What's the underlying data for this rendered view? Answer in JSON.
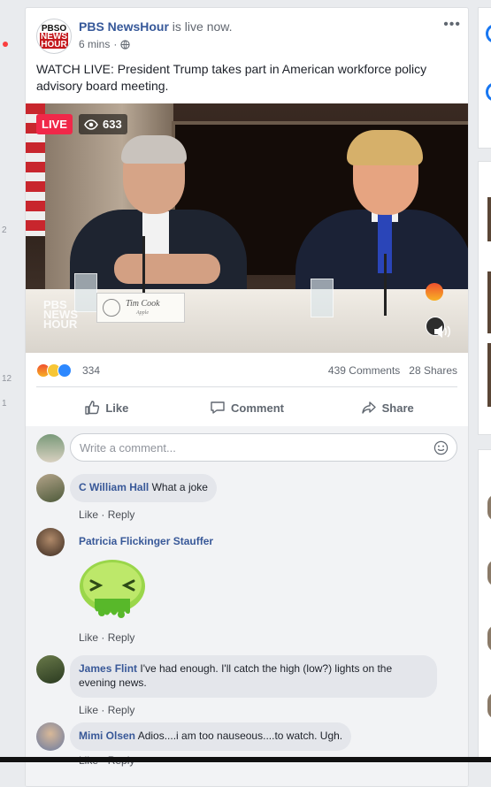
{
  "gutter": {
    "numbers": [
      "2",
      "12",
      "1"
    ]
  },
  "post": {
    "page_name": "PBS NewsHour",
    "live_status": " is live now.",
    "time_ago": "6 mins",
    "audience_icon": "globe-icon",
    "more_icon": "more-horizontal-icon",
    "avatar_lines": [
      "PBSO",
      "NEWS",
      "HOUR"
    ],
    "text": "WATCH LIVE: President Trump takes part in American workforce policy advisory board meeting.",
    "video": {
      "live_label": "LIVE",
      "viewer_count": "633",
      "placard_name": "Tim Cook",
      "placard_company": "Apple",
      "watermark_lines": [
        "PBS",
        "NEWS",
        "HOUR"
      ]
    },
    "reactions": {
      "icons": [
        "angry",
        "haha",
        "like"
      ],
      "count": "334"
    },
    "comments_count": "439 Comments",
    "shares_count": "28 Shares",
    "actions": {
      "like": "Like",
      "comment": "Comment",
      "share": "Share"
    }
  },
  "composer": {
    "placeholder": "Write a comment..."
  },
  "comments": [
    {
      "author": "C William Hall",
      "text": "What a joke",
      "like": "Like",
      "sep": " · ",
      "reply": "Reply"
    },
    {
      "author": "Patricia Flickinger Stauffer",
      "text": "",
      "like": "Like",
      "sep": " · ",
      "reply": "Reply",
      "sticker": "nauseous-face-sticker"
    },
    {
      "author": "James Flint",
      "text": "I've had enough. I'll catch the high (low?) lights on the evening news.",
      "like": "Like",
      "sep": " · ",
      "reply": "Reply"
    },
    {
      "author": "Mimi Olsen",
      "text": "Adios....i am too nauseous....to watch. Ugh.",
      "like": "Like",
      "sep": " · ",
      "reply": "Reply"
    }
  ],
  "colors": {
    "live_red": "#f02849",
    "link_blue": "#365899",
    "background": "#e9ebee"
  }
}
